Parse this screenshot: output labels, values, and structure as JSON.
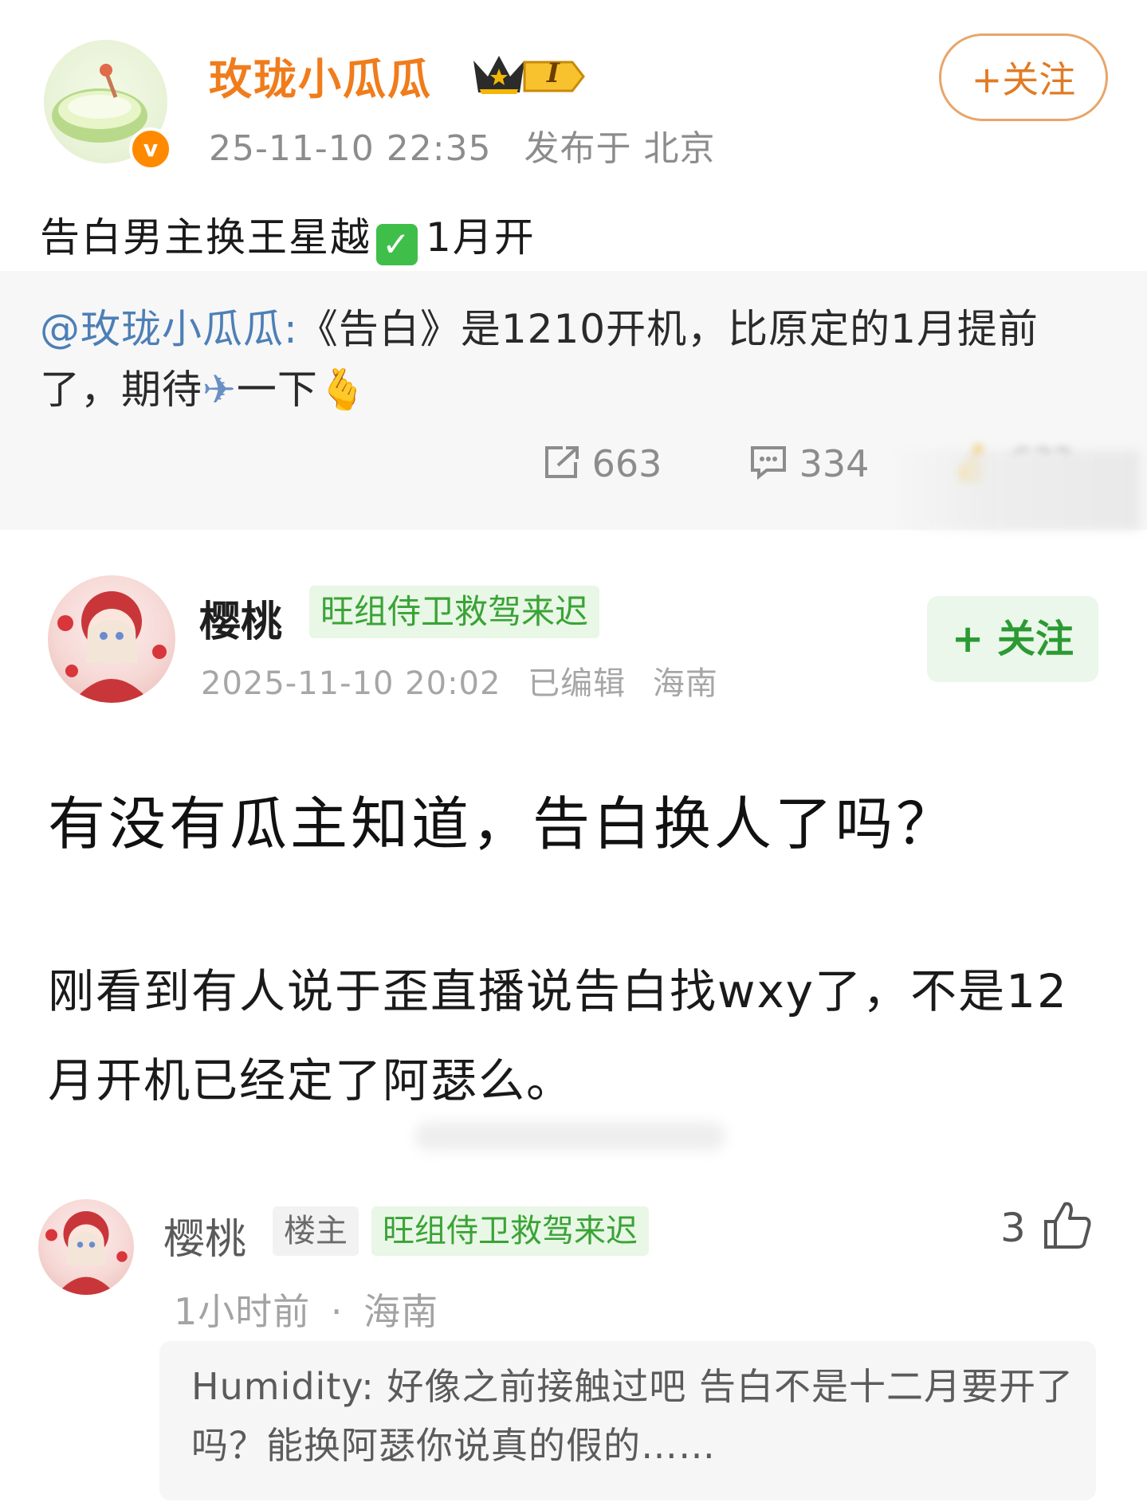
{
  "post1": {
    "username": "玫珑小瓜瓜",
    "level_badge": "I",
    "verified_badge": "v",
    "timestamp": "25-11-10 22:35",
    "location": "发布于 北京",
    "follow_label": "+关注",
    "text_before": "告白男主换王星越",
    "check_mark": "✓",
    "text_after": "1月开",
    "repost": {
      "mention": "@玫珑小瓜瓜:",
      "text": "《告白》是1210开机，比原定的1月提前了，期待",
      "emoji_plane": "✈",
      "text_end": "一下",
      "emoji_heart": "🫰"
    },
    "actions": {
      "repost_count": "663",
      "comment_count": "334",
      "like_count": "6??"
    }
  },
  "post2": {
    "username": "樱桃",
    "tag": "旺组侍卫救驾来迟",
    "timestamp": "2025-11-10 20:02",
    "edited": "已编辑",
    "location": "海南",
    "follow_label": "+ 关注",
    "title": "有没有瓜主知道，告白换人了吗？",
    "body": "刚看到有人说于歪直播说告白找wxy了，不是12月开机已经定了阿瑟么。"
  },
  "comment": {
    "username": "樱桃",
    "op_tag": "楼主",
    "tag": "旺组侍卫救驾来迟",
    "likes": "3",
    "time": "1小时前",
    "dot": "·",
    "location": "海南",
    "quote": "Humidity: 好像之前接触过吧 告白不是十二月要开了吗？能换阿瑟你说真的假的……"
  },
  "colors": {
    "weibo_orange": "#f07c1c",
    "link_blue": "#4d7fb6",
    "douban_green": "#3aa336"
  }
}
